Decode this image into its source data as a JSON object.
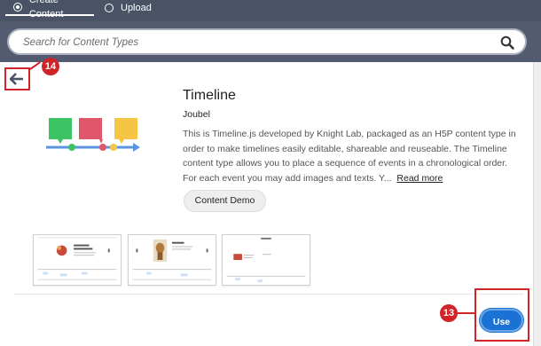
{
  "tabs": [
    {
      "label": "Create Content",
      "selected": true
    },
    {
      "label": "Upload",
      "selected": false
    }
  ],
  "search": {
    "placeholder": "Search for Content Types",
    "value": "",
    "icon": "search-icon"
  },
  "back_button": {
    "icon": "arrow-left-icon"
  },
  "callouts": {
    "back": "14",
    "use": "13"
  },
  "content_type": {
    "title": "Timeline",
    "owner": "Joubel",
    "description": "This is Timeline.js developed by Knight Lab, packaged as an H5P content type in order to make timelines easily editable, shareable and reuseable. The Timeline content type allows you to place a sequence of events in a chronological order. For each event you may add images and texts. Y...",
    "read_more": "Read more",
    "demo_button": "Content Demo",
    "use_button": "Use"
  },
  "screenshots": [
    "screenshot-1",
    "screenshot-2",
    "screenshot-3"
  ],
  "colors": {
    "topbar": "#4a5266",
    "search_band": "#525b6f",
    "highlight_red": "#d02428",
    "primary_blue": "#1a73d4",
    "icon_green": "#3cc464",
    "icon_red": "#e0566b",
    "icon_yellow": "#f5c543",
    "icon_blue": "#5b95e0"
  }
}
